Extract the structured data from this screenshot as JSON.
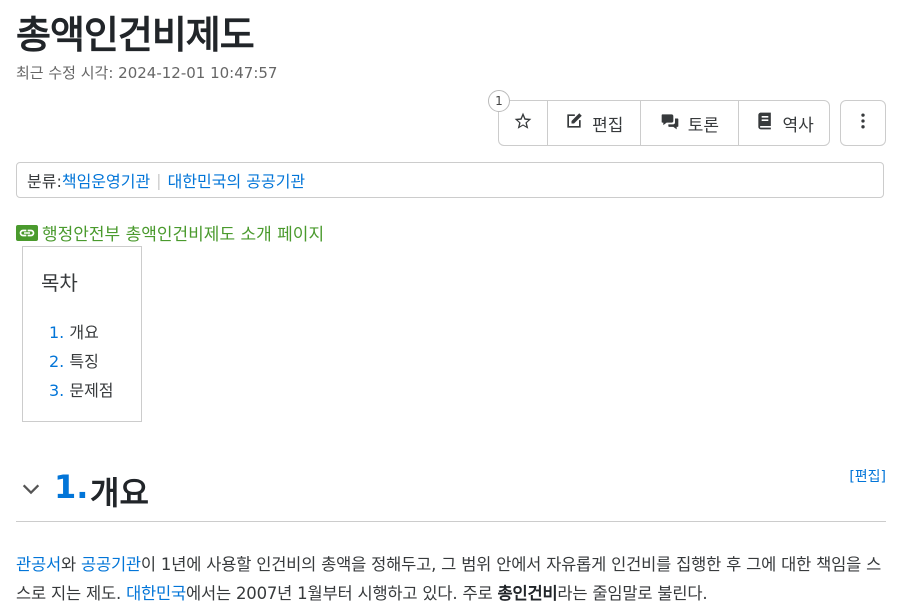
{
  "page": {
    "title": "총액인건비제도",
    "last_edited": "최근 수정 시각: 2024-12-01 10:47:57"
  },
  "actions": {
    "star_count": "1",
    "edit_label": "편집",
    "discuss_label": "토론",
    "history_label": "역사"
  },
  "category": {
    "label": "분류:",
    "items": [
      "책임운영기관",
      "대한민국의 공공기관"
    ]
  },
  "external_link": "행정안전부 총액인건비제도 소개 페이지",
  "toc": {
    "title": "목차",
    "items": [
      {
        "num": "1.",
        "label": "개요"
      },
      {
        "num": "2.",
        "label": "특징"
      },
      {
        "num": "3.",
        "label": "문제점"
      }
    ]
  },
  "section": {
    "num": "1.",
    "title": "개요",
    "edit": "[편집]"
  },
  "paragraph": {
    "link1": "관공서",
    "t1": "와 ",
    "link2": "공공기관",
    "t2": "이 1년에 사용할 인건비의 총액을 정해두고, 그 범위 안에서 자유롭게 인건비를 집행한 후 그에 대한 책임을 스스로 지는 제도. ",
    "link3": "대한민국",
    "t3": "에서는 2007년 1월부터 시행하고 있다. 주로 ",
    "bold": "총인건비",
    "t4": "라는 줄임말로 불린다."
  },
  "icons": {
    "star": "star-icon",
    "edit": "pencil-icon",
    "discuss": "chat-icon",
    "history": "book-icon",
    "more": "vertical-dots-icon",
    "external": "link-icon",
    "collapse": "chevron-down-icon"
  }
}
